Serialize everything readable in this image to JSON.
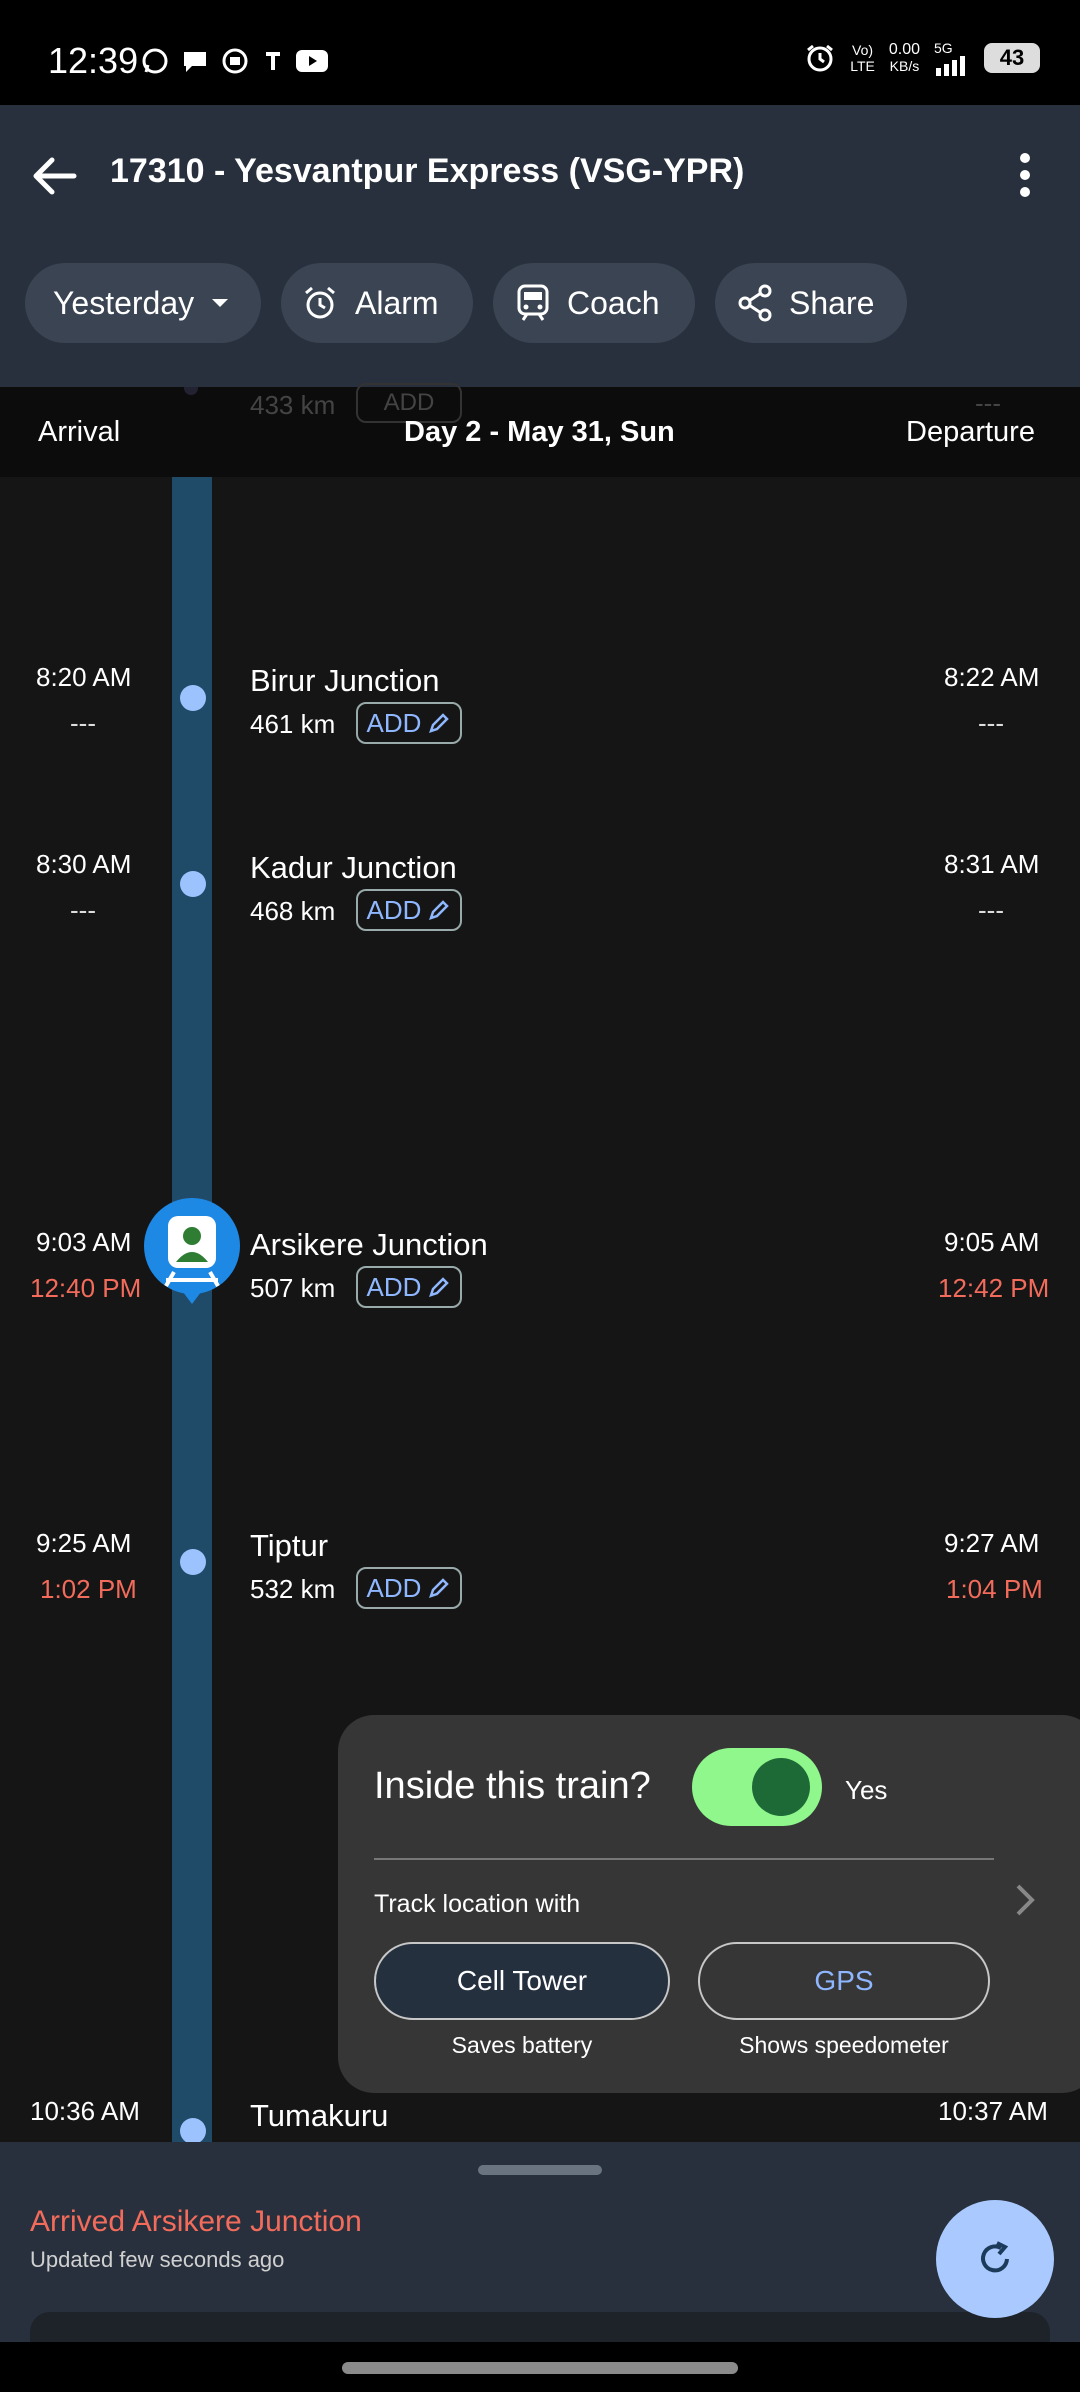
{
  "status": {
    "time": "12:39",
    "network": "0.00",
    "network_unit": "KB/s",
    "volte": "Vo)",
    "lte": "LTE",
    "gen": "5G",
    "battery": "43"
  },
  "app_bar": {
    "title": "17310 - Yesvantpur Express (VSG-YPR)",
    "chips": [
      "Yesterday",
      "Alarm",
      "Coach",
      "Share"
    ]
  },
  "timeline": {
    "arrival_label": "Arrival",
    "departure_label": "Departure",
    "day_label": "Day 2 - May 31, Sun",
    "faded_km": "433 km",
    "faded_dash": "---",
    "add_label": "ADD",
    "stations": [
      {
        "name": "Birur Junction",
        "km": "461 km",
        "arr": "8:20 AM",
        "arr_actual": "---",
        "dep": "8:22 AM",
        "dep_actual": "---"
      },
      {
        "name": "Kadur Junction",
        "km": "468 km",
        "arr": "8:30 AM",
        "arr_actual": "---",
        "dep": "8:31 AM",
        "dep_actual": "---"
      },
      {
        "name": "Arsikere Junction",
        "km": "507 km",
        "arr": "9:03 AM",
        "arr_actual": "12:40 PM",
        "dep": "9:05 AM",
        "dep_actual": "12:42 PM"
      },
      {
        "name": "Tiptur",
        "km": "532 km",
        "arr": "9:25 AM",
        "arr_actual": "1:02 PM",
        "dep": "9:27 AM",
        "dep_actual": "1:04 PM"
      },
      {
        "name": "Tumakuru",
        "arr": "10:36 AM",
        "dep": "10:37 AM"
      }
    ]
  },
  "inside_card": {
    "title": "Inside this train?",
    "toggle_label": "Yes",
    "toggle_on": true,
    "track_label": "Track location with",
    "options": [
      {
        "label": "Cell Tower",
        "sub": "Saves battery"
      },
      {
        "label": "GPS",
        "sub": "Shows speedometer"
      }
    ]
  },
  "bottom_sheet": {
    "status": "Arrived Arsikere Junction",
    "updated": "Updated few seconds ago"
  },
  "colors": {
    "late": "#f26b5b",
    "accent_blue": "#8fb7ff",
    "toggle_on": "#8ff78c",
    "rail": "#1f4a68"
  }
}
